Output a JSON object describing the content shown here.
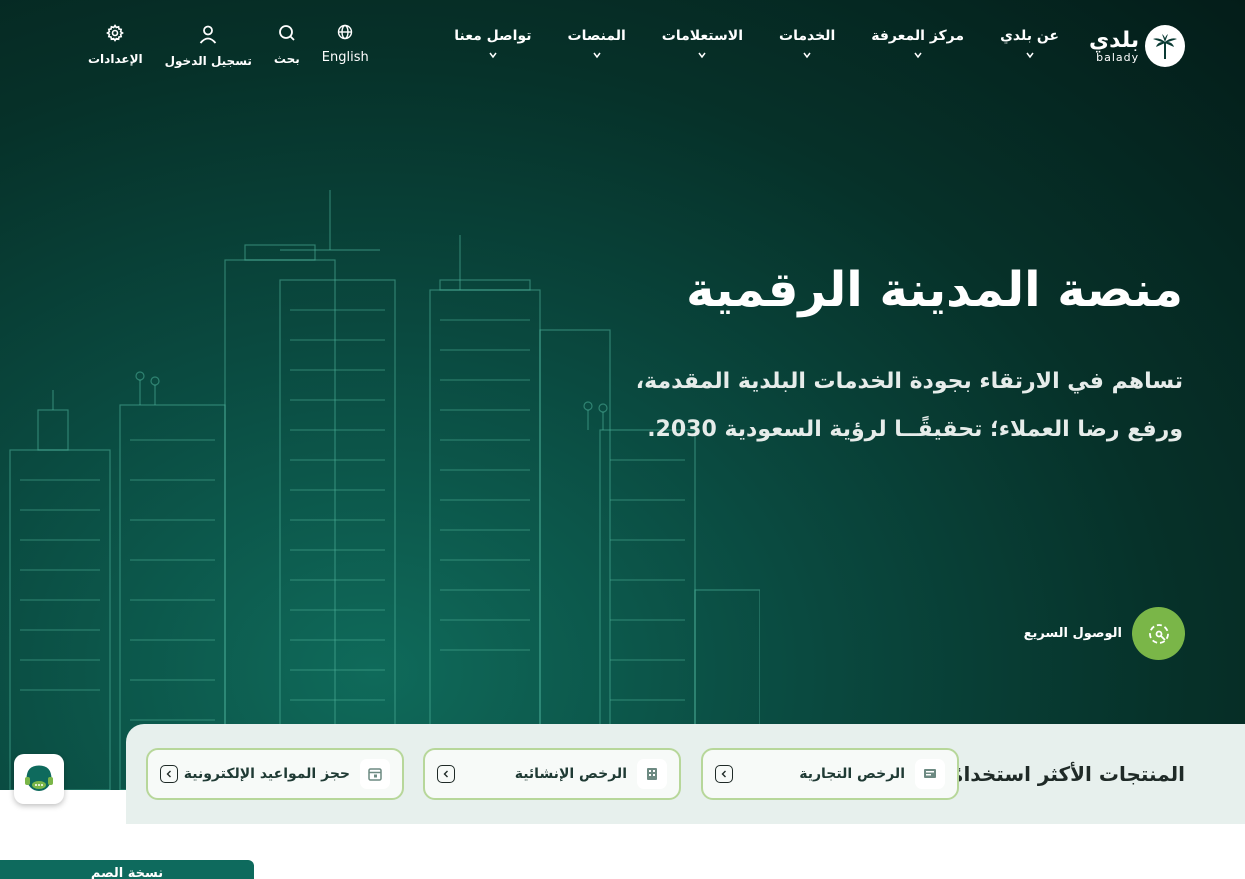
{
  "header": {
    "logo": {
      "arabic": "بلدي",
      "latin": "balady"
    },
    "nav": [
      {
        "label": "عن بلدي"
      },
      {
        "label": "مركز المعرفة"
      },
      {
        "label": "الخدمات"
      },
      {
        "label": "الاستعلامات"
      },
      {
        "label": "المنصات"
      },
      {
        "label": "تواصل معنا"
      }
    ],
    "tools": {
      "language": "English",
      "search": "بحث",
      "login": "تسجيل الدخول",
      "settings": "الإعدادات"
    }
  },
  "hero": {
    "title": "منصة المدينة الرقمية",
    "subtitle": "تساهم في الارتقاء بجودة الخدمات البلدية المقدمة، ورفع رضا العملاء؛ تحقيقًــا لرؤية السعودية 2030."
  },
  "quick_access": {
    "label": "الوصول السريع"
  },
  "products": {
    "title": "المنتجات الأكثر استخدامًا",
    "items": [
      {
        "label": "الرخص التجارية"
      },
      {
        "label": "الرخص الإنشائية"
      },
      {
        "label": "حجز المواعيد الإلكترونية"
      }
    ]
  },
  "bottom_tab": {
    "label": "نسخة الصم"
  },
  "colors": {
    "accent": "#7ab648",
    "primary": "#0e6a5d",
    "hero_dark": "#041d19"
  }
}
